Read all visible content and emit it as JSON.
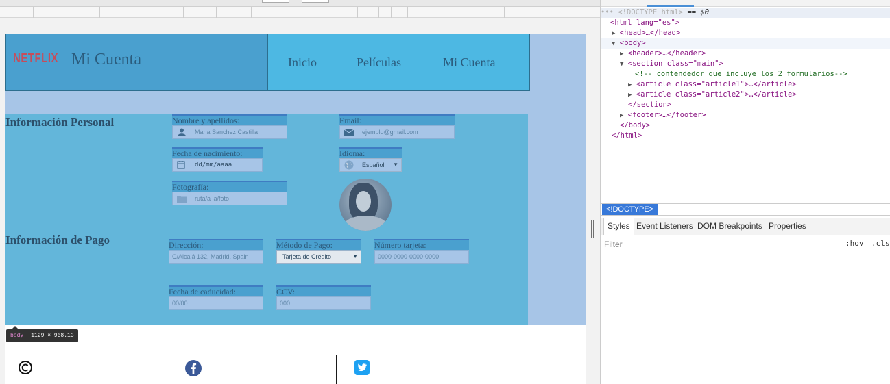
{
  "site": {
    "logo_text": "NETFLIX",
    "title": "Mi Cuenta",
    "nav": [
      {
        "label": "Inicio"
      },
      {
        "label": "Películas"
      },
      {
        "label": "Mi Cuenta"
      }
    ]
  },
  "personal": {
    "heading": "Información Personal",
    "name": {
      "label": "Nombre y apellidos:",
      "placeholder": "Maria Sanchez Castilla",
      "icon": "user-icon"
    },
    "email": {
      "label": "Email:",
      "placeholder": "ejemplo@gmail.com",
      "icon": "envelope-icon"
    },
    "birthdate": {
      "label": "Fecha de nacimiento:",
      "placeholder": "dd/mm/aaaa",
      "icon": "calendar-icon"
    },
    "language": {
      "label": "Idioma:",
      "value": "Español",
      "icon": "globe-icon"
    },
    "photo": {
      "label": "Fotografía:",
      "placeholder": "ruta/a la/foto",
      "icon": "folder-icon"
    }
  },
  "payment": {
    "heading": "Información de Pago",
    "address": {
      "label": "Dirección:",
      "placeholder": "C/Alcalá 132, Madrid, Spain"
    },
    "method": {
      "label": "Método de Pago:",
      "value": "Tarjeta de Crédito"
    },
    "card_number": {
      "label": "Número tarjeta:",
      "placeholder": "0000-0000-0000-0000"
    },
    "expiry": {
      "label": "Fecha de caducidad:",
      "placeholder": "00/00"
    },
    "ccv": {
      "label": "CCV:",
      "placeholder": "000"
    }
  },
  "footer": {
    "copyright_symbol": "©",
    "icons": [
      "copyright-icon",
      "facebook-icon",
      "twitter-icon"
    ]
  },
  "tooltip": {
    "tag": "body",
    "size": "1129 × 968.13"
  },
  "devtools": {
    "dom": {
      "doctype": "<!DOCTYPE html>",
      "doctype_suffix": "== $0",
      "html_open": "<html lang=\"es\">",
      "head": "<head>…</head>",
      "body_open": "<body>",
      "header": "<header>…</header>",
      "section_open": "<section class=\"main\">",
      "comment": "<!-- contendedor que incluye los 2 formularios-->",
      "article1": "<article class=\"article1\">…</article>",
      "article2": "<article class=\"article2\">…</article>",
      "section_close": "</section>",
      "footer": "<footer>…</footer>",
      "body_close": "</body>",
      "html_close": "</html>"
    },
    "breadcrumb": "<!DOCTYPE>",
    "tabs": [
      "Styles",
      "Event Listeners",
      "DOM Breakpoints",
      "Properties"
    ],
    "active_tab": "Styles",
    "filter_placeholder": "Filter",
    "hov_label": ":hov",
    "cls_label": ".cls"
  },
  "colors": {
    "header_left": "#4aa0cf",
    "header_right": "#4db8e3",
    "form_bg": "#63b6da",
    "page_overlay": "#a7c5e7",
    "logo": "#c74c5a",
    "twitter": "#1da1f2",
    "facebook": "#3b5998",
    "devtools_accent": "#3879d9"
  }
}
